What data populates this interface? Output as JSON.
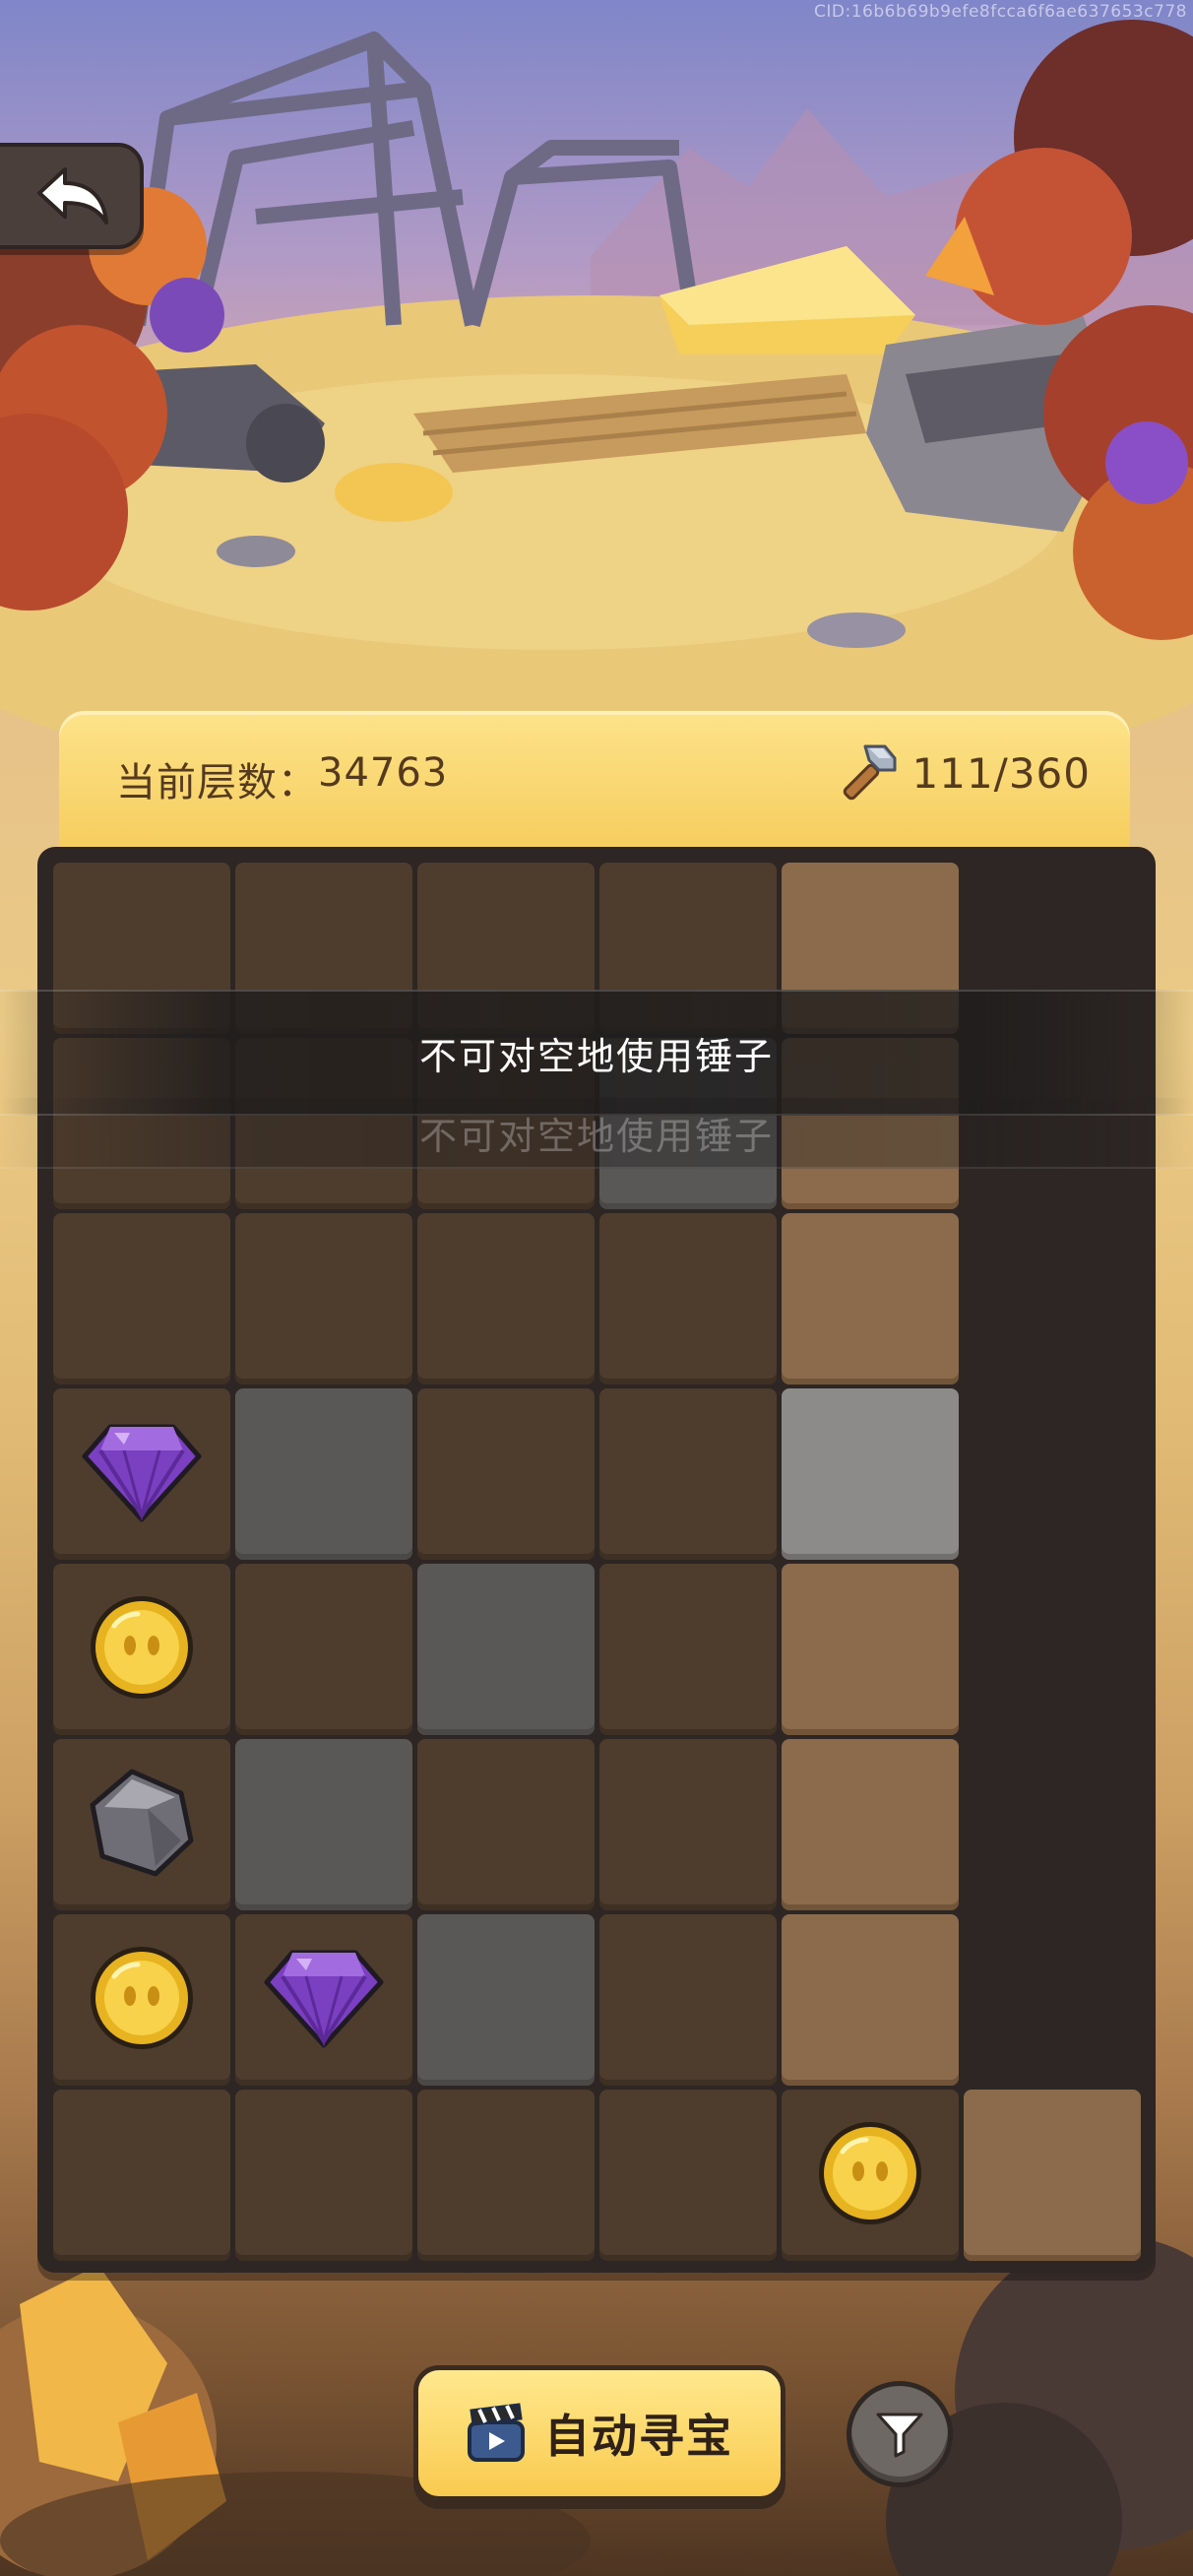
{
  "cid": "CID:16b6b69b9efe8fcca6f6ae637653c778",
  "header": {
    "layer_label": "当前层数：",
    "layer_value": "34763",
    "hammer_count": "111/360"
  },
  "toast": {
    "message": "不可对空地使用锤子"
  },
  "board": {
    "columns": 6,
    "rows": 8,
    "cells": [
      [
        "dirt",
        "dirt",
        "dirt",
        "dirt",
        "sand",
        "empty"
      ],
      [
        "dirt",
        "dirt",
        "dirt",
        "stone",
        "sand",
        "empty"
      ],
      [
        "dirt",
        "dirt",
        "dirt",
        "dirt",
        "sand",
        "empty"
      ],
      [
        "dirt",
        "stone",
        "dirt",
        "dirt",
        "lightstone",
        "empty"
      ],
      [
        "dirt",
        "dirt",
        "stone",
        "dirt",
        "sand",
        "empty"
      ],
      [
        "dirt",
        "stone",
        "dirt",
        "dirt",
        "sand",
        "empty"
      ],
      [
        "dirt",
        "dirt",
        "stone",
        "dirt",
        "sand",
        "empty"
      ],
      [
        "dirt",
        "dirt",
        "dirt",
        "dirt",
        "dirt",
        "sand"
      ]
    ],
    "items": [
      {
        "row": 3,
        "col": 0,
        "type": "purple-gem-icon"
      },
      {
        "row": 4,
        "col": 0,
        "type": "gold-coin-icon"
      },
      {
        "row": 5,
        "col": 0,
        "type": "gray-stone-icon"
      },
      {
        "row": 6,
        "col": 0,
        "type": "gold-coin-icon"
      },
      {
        "row": 6,
        "col": 1,
        "type": "purple-gem-icon"
      },
      {
        "row": 7,
        "col": 4,
        "type": "gold-coin-icon"
      }
    ]
  },
  "buttons": {
    "auto_treasure_label": "自动寻宝"
  },
  "colors": {
    "header_yellow": "#f6cd5e",
    "board_bg": "#2d2624",
    "dirt": "#4e3c2d",
    "stone": "#5a5857",
    "sand": "#8b6b4b",
    "light_stone": "#8d8b89"
  }
}
